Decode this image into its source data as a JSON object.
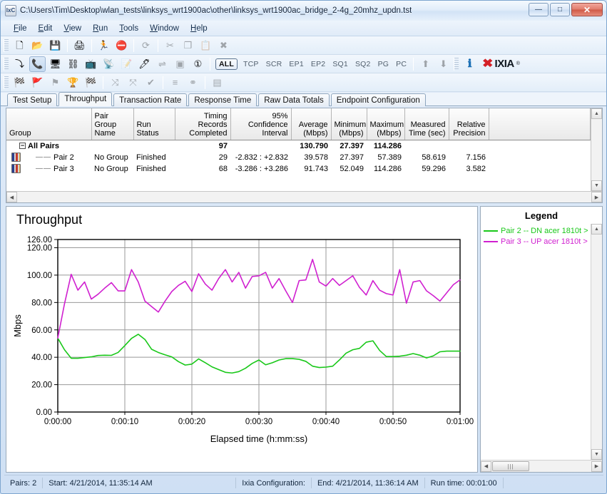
{
  "window": {
    "title": "C:\\Users\\Tim\\Desktop\\wlan_tests\\linksys_wrt1900ac\\other\\linksys_wrt1900ac_bridge_2-4g_20mhz_updn.tst",
    "app_icon": "IxC",
    "minimize": "—",
    "maximize": "□",
    "close": "✕"
  },
  "menu": [
    {
      "label": "File",
      "accel": "F"
    },
    {
      "label": "Edit",
      "accel": "E"
    },
    {
      "label": "View",
      "accel": "V"
    },
    {
      "label": "Run",
      "accel": "R"
    },
    {
      "label": "Tools",
      "accel": "T"
    },
    {
      "label": "Window",
      "accel": "W"
    },
    {
      "label": "Help",
      "accel": "H"
    }
  ],
  "toolbar": {
    "row1": [
      {
        "name": "new-icon",
        "glyph": "🗋",
        "dim": false
      },
      {
        "name": "open-folder-icon",
        "glyph": "📂",
        "dim": false
      },
      {
        "name": "save-icon",
        "glyph": "💾",
        "dim": false
      },
      {
        "name": "sep",
        "glyph": "",
        "dim": false
      },
      {
        "name": "print-icon",
        "glyph": "🖨",
        "dim": false
      },
      {
        "name": "sep",
        "glyph": "",
        "dim": false
      },
      {
        "name": "run-test-icon",
        "glyph": "🏃",
        "dim": false
      },
      {
        "name": "stop-test-icon",
        "glyph": "⛔",
        "dim": false
      },
      {
        "name": "sep",
        "glyph": "",
        "dim": false
      },
      {
        "name": "refresh-icon",
        "glyph": "⟳",
        "dim": true
      },
      {
        "name": "sep",
        "glyph": "",
        "dim": false
      },
      {
        "name": "cut-icon",
        "glyph": "✂",
        "dim": true
      },
      {
        "name": "copy-icon",
        "glyph": "❐",
        "dim": true
      },
      {
        "name": "paste-icon",
        "glyph": "📋",
        "dim": true
      },
      {
        "name": "delete-icon",
        "glyph": "✖",
        "dim": true
      }
    ],
    "row2": [
      {
        "name": "endpoint-pair-icon",
        "glyph": "⤵",
        "dim": false
      },
      {
        "name": "call-pair-icon",
        "glyph": "📞",
        "dim": false,
        "pressed": true
      },
      {
        "name": "monitor-icon",
        "glyph": "🖥",
        "dim": false
      },
      {
        "name": "network-node-icon",
        "glyph": "⛓",
        "dim": false
      },
      {
        "name": "video-monitor-icon",
        "glyph": "📺",
        "dim": false
      },
      {
        "name": "broadcast-icon",
        "glyph": "📡",
        "dim": false
      },
      {
        "name": "edit-script-icon",
        "glyph": "📝",
        "dim": true
      },
      {
        "name": "pen-monitor-icon",
        "glyph": "🖊",
        "dim": false
      },
      {
        "name": "flow-icon",
        "glyph": "⇌",
        "dim": true
      },
      {
        "name": "group-icon",
        "glyph": "▣",
        "dim": true
      },
      {
        "name": "numbering-icon",
        "glyph": "①",
        "dim": false
      }
    ],
    "filters": [
      "ALL",
      "TCP",
      "SCR",
      "EP1",
      "EP2",
      "SQ1",
      "SQ2",
      "PG",
      "PC"
    ],
    "active_filter": "ALL",
    "row2_tail": [
      {
        "name": "export-icon",
        "glyph": "⬆",
        "dim": true
      },
      {
        "name": "import-icon",
        "glyph": "⬇",
        "dim": true
      }
    ],
    "help-button": "ℹ",
    "brand": {
      "x": "✖",
      "text": "IXIA",
      "mark": "®"
    },
    "row3": [
      {
        "name": "chart-results-icon",
        "glyph": "🏁",
        "dim": false
      },
      {
        "name": "start-flag-icon",
        "glyph": "🚩",
        "dim": false
      },
      {
        "name": "pause-flag-icon",
        "glyph": "⚑",
        "dim": true
      },
      {
        "name": "finish-trophy-icon",
        "glyph": "🏆",
        "dim": false
      },
      {
        "name": "checker-flag-icon",
        "glyph": "🏁",
        "dim": false
      },
      {
        "name": "sep",
        "glyph": "",
        "dim": false
      },
      {
        "name": "align-nodes-icon",
        "glyph": "⤨",
        "dim": true
      },
      {
        "name": "split-nodes-icon",
        "glyph": "⤧",
        "dim": true
      },
      {
        "name": "verify-nodes-icon",
        "glyph": "✔",
        "dim": true
      },
      {
        "name": "sep",
        "glyph": "",
        "dim": false
      },
      {
        "name": "distribute-icon",
        "glyph": "≡",
        "dim": true
      },
      {
        "name": "link-pairs-icon",
        "glyph": "⚭",
        "dim": true
      },
      {
        "name": "sep",
        "glyph": "",
        "dim": false
      },
      {
        "name": "table-view-icon",
        "glyph": "▤",
        "dim": true
      }
    ]
  },
  "tabs": [
    {
      "label": "Test Setup",
      "active": false
    },
    {
      "label": "Throughput",
      "active": true
    },
    {
      "label": "Transaction Rate",
      "active": false
    },
    {
      "label": "Response Time",
      "active": false
    },
    {
      "label": "Raw Data Totals",
      "active": false
    },
    {
      "label": "Endpoint Configuration",
      "active": false
    }
  ],
  "table": {
    "columns": [
      "Group",
      "Pair Group Name",
      "Run Status",
      "Timing Records Completed",
      "95% Confidence Interval",
      "Average (Mbps)",
      "Minimum (Mbps)",
      "Maximum (Mbps)",
      "Measured Time (sec)",
      "Relative Precision"
    ],
    "rows": [
      {
        "type": "group",
        "group": "All Pairs",
        "pair_group_name": "",
        "run_status": "",
        "timing_records": "97",
        "confidence": "",
        "average": "130.790",
        "minimum": "27.397",
        "maximum": "114.286",
        "measured_time": "",
        "relative_precision": ""
      },
      {
        "type": "pair",
        "group": "Pair 2",
        "pair_group_name": "No Group",
        "run_status": "Finished",
        "timing_records": "29",
        "confidence": "-2.832 : +2.832",
        "average": "39.578",
        "minimum": "27.397",
        "maximum": "57.389",
        "measured_time": "58.619",
        "relative_precision": "7.156"
      },
      {
        "type": "pair",
        "group": "Pair 3",
        "pair_group_name": "No Group",
        "run_status": "Finished",
        "timing_records": "68",
        "confidence": "-3.286 : +3.286",
        "average": "91.743",
        "minimum": "52.049",
        "maximum": "114.286",
        "measured_time": "59.296",
        "relative_precision": "3.582"
      }
    ]
  },
  "legend": {
    "title": "Legend",
    "items": [
      {
        "label": "Pair 2 -- DN acer 1810t >",
        "color": "#19c819"
      },
      {
        "label": "Pair 3 -- UP acer 1810t >",
        "color": "#d020d0"
      }
    ]
  },
  "statusbar": {
    "pairs": "Pairs: 2",
    "start": "Start: 4/21/2014, 11:35:14 AM",
    "configuration": "Ixia Configuration:",
    "end": "End: 4/21/2014, 11:36:14 AM",
    "runtime": "Run time: 00:01:00"
  },
  "chart_data": {
    "type": "line",
    "title": "Throughput",
    "xlabel": "Elapsed time (h:mm:ss)",
    "ylabel": "Mbps",
    "ylim": [
      0,
      126
    ],
    "yticks": [
      0,
      20,
      40,
      60,
      80,
      100,
      120,
      126
    ],
    "yticklabels": [
      "0.00",
      "20.00",
      "40.00",
      "60.00",
      "80.00",
      "100.00",
      "120.00",
      "126.00"
    ],
    "xlim": [
      0,
      60
    ],
    "xticks": [
      0,
      10,
      20,
      30,
      40,
      50,
      60
    ],
    "xticklabels": [
      "0:00:00",
      "0:00:10",
      "0:00:20",
      "0:00:30",
      "0:00:40",
      "0:00:50",
      "0:01:00"
    ],
    "grid": true,
    "legend_position": "right-panel",
    "series": [
      {
        "name": "Pair 2 -- DN acer 1810t >",
        "color": "#19c819",
        "x": [
          0.0,
          1.0,
          2.0,
          3.0,
          4.0,
          5.0,
          6.0,
          7.0,
          8.0,
          9.0,
          10.0,
          11.0,
          12.0,
          13.0,
          14.0,
          15.0,
          16.0,
          17.0,
          18.0,
          19.0,
          20.0,
          21.0,
          22.0,
          23.0,
          24.0,
          25.0,
          26.0,
          27.0,
          28.0,
          29.0,
          30.0,
          31.0,
          32.0,
          33.0,
          34.0,
          35.0,
          36.0,
          37.0,
          38.0,
          39.0,
          40.0,
          41.0,
          42.0,
          43.0,
          44.0,
          45.0,
          46.0,
          47.0,
          48.0,
          49.0,
          50.0,
          51.0,
          52.0,
          53.0,
          54.0,
          55.0,
          56.0,
          57.0,
          58.0,
          59.0,
          60.0
        ],
        "y": [
          54.0,
          45.5,
          39.3,
          39.3,
          39.8,
          40.3,
          41.3,
          41.5,
          41.4,
          43.5,
          48.5,
          53.8,
          56.8,
          53.0,
          45.8,
          43.5,
          41.8,
          40.3,
          36.8,
          34.3,
          35.0,
          38.8,
          36.0,
          33.0,
          31.0,
          29.0,
          28.5,
          29.5,
          32.0,
          35.5,
          38.0,
          34.5,
          36.0,
          38.0,
          39.0,
          39.0,
          38.5,
          37.0,
          33.5,
          32.5,
          32.8,
          33.5,
          38.0,
          43.0,
          45.5,
          46.5,
          51.0,
          52.0,
          45.0,
          40.5,
          40.5,
          40.8,
          41.5,
          42.7,
          41.5,
          39.5,
          41.0,
          44.0,
          44.5,
          44.5,
          44.5
        ]
      },
      {
        "name": "Pair 3 -- UP acer 1810t >",
        "color": "#d020d0",
        "x": [
          0.0,
          1.0,
          2.0,
          3.0,
          4.0,
          5.0,
          6.0,
          7.0,
          8.0,
          9.0,
          10.0,
          11.0,
          12.0,
          13.0,
          14.0,
          15.0,
          16.0,
          17.0,
          18.0,
          19.0,
          20.0,
          21.0,
          22.0,
          23.0,
          24.0,
          25.0,
          26.0,
          27.0,
          28.0,
          29.0,
          30.0,
          31.0,
          32.0,
          33.0,
          34.0,
          35.0,
          36.0,
          37.0,
          38.0,
          39.0,
          40.0,
          41.0,
          42.0,
          43.0,
          44.0,
          45.0,
          46.0,
          47.0,
          48.0,
          49.0,
          50.0,
          51.0,
          52.0,
          53.0,
          54.0,
          55.0,
          56.0,
          57.0,
          58.0,
          59.0,
          60.0
        ],
        "y": [
          54.0,
          79.0,
          100.6,
          89.0,
          95.0,
          82.5,
          86.0,
          90.5,
          94.5,
          88.5,
          88.5,
          104.0,
          95.0,
          81.0,
          77.0,
          73.0,
          81.0,
          88.0,
          92.5,
          95.5,
          88.0,
          101.0,
          93.5,
          89.0,
          97.5,
          104.0,
          95.0,
          102.0,
          90.5,
          99.0,
          99.5,
          102.0,
          90.5,
          97.5,
          88.5,
          80.0,
          96.0,
          96.5,
          111.5,
          95.0,
          92.0,
          97.5,
          92.5,
          96.0,
          99.5,
          91.0,
          85.5,
          96.0,
          89.0,
          86.5,
          85.5,
          104.0,
          79.5,
          95.0,
          96.0,
          88.5,
          85.0,
          81.0,
          87.0,
          93.0,
          96.5
        ]
      }
    ]
  }
}
